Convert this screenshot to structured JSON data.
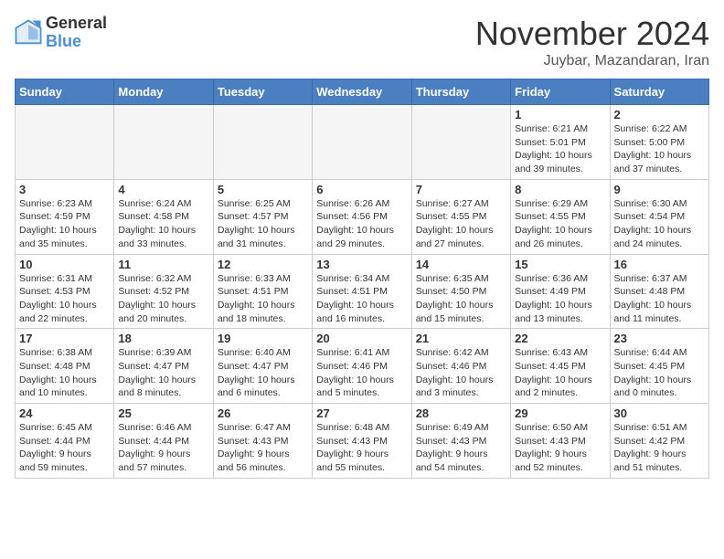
{
  "header": {
    "logo_general": "General",
    "logo_blue": "Blue",
    "month_title": "November 2024",
    "location": "Juybar, Mazandaran, Iran"
  },
  "weekdays": [
    "Sunday",
    "Monday",
    "Tuesday",
    "Wednesday",
    "Thursday",
    "Friday",
    "Saturday"
  ],
  "weeks": [
    [
      {
        "day": "",
        "info": ""
      },
      {
        "day": "",
        "info": ""
      },
      {
        "day": "",
        "info": ""
      },
      {
        "day": "",
        "info": ""
      },
      {
        "day": "",
        "info": ""
      },
      {
        "day": "1",
        "info": "Sunrise: 6:21 AM\nSunset: 5:01 PM\nDaylight: 10 hours\nand 39 minutes."
      },
      {
        "day": "2",
        "info": "Sunrise: 6:22 AM\nSunset: 5:00 PM\nDaylight: 10 hours\nand 37 minutes."
      }
    ],
    [
      {
        "day": "3",
        "info": "Sunrise: 6:23 AM\nSunset: 4:59 PM\nDaylight: 10 hours\nand 35 minutes."
      },
      {
        "day": "4",
        "info": "Sunrise: 6:24 AM\nSunset: 4:58 PM\nDaylight: 10 hours\nand 33 minutes."
      },
      {
        "day": "5",
        "info": "Sunrise: 6:25 AM\nSunset: 4:57 PM\nDaylight: 10 hours\nand 31 minutes."
      },
      {
        "day": "6",
        "info": "Sunrise: 6:26 AM\nSunset: 4:56 PM\nDaylight: 10 hours\nand 29 minutes."
      },
      {
        "day": "7",
        "info": "Sunrise: 6:27 AM\nSunset: 4:55 PM\nDaylight: 10 hours\nand 27 minutes."
      },
      {
        "day": "8",
        "info": "Sunrise: 6:29 AM\nSunset: 4:55 PM\nDaylight: 10 hours\nand 26 minutes."
      },
      {
        "day": "9",
        "info": "Sunrise: 6:30 AM\nSunset: 4:54 PM\nDaylight: 10 hours\nand 24 minutes."
      }
    ],
    [
      {
        "day": "10",
        "info": "Sunrise: 6:31 AM\nSunset: 4:53 PM\nDaylight: 10 hours\nand 22 minutes."
      },
      {
        "day": "11",
        "info": "Sunrise: 6:32 AM\nSunset: 4:52 PM\nDaylight: 10 hours\nand 20 minutes."
      },
      {
        "day": "12",
        "info": "Sunrise: 6:33 AM\nSunset: 4:51 PM\nDaylight: 10 hours\nand 18 minutes."
      },
      {
        "day": "13",
        "info": "Sunrise: 6:34 AM\nSunset: 4:51 PM\nDaylight: 10 hours\nand 16 minutes."
      },
      {
        "day": "14",
        "info": "Sunrise: 6:35 AM\nSunset: 4:50 PM\nDaylight: 10 hours\nand 15 minutes."
      },
      {
        "day": "15",
        "info": "Sunrise: 6:36 AM\nSunset: 4:49 PM\nDaylight: 10 hours\nand 13 minutes."
      },
      {
        "day": "16",
        "info": "Sunrise: 6:37 AM\nSunset: 4:48 PM\nDaylight: 10 hours\nand 11 minutes."
      }
    ],
    [
      {
        "day": "17",
        "info": "Sunrise: 6:38 AM\nSunset: 4:48 PM\nDaylight: 10 hours\nand 10 minutes."
      },
      {
        "day": "18",
        "info": "Sunrise: 6:39 AM\nSunset: 4:47 PM\nDaylight: 10 hours\nand 8 minutes."
      },
      {
        "day": "19",
        "info": "Sunrise: 6:40 AM\nSunset: 4:47 PM\nDaylight: 10 hours\nand 6 minutes."
      },
      {
        "day": "20",
        "info": "Sunrise: 6:41 AM\nSunset: 4:46 PM\nDaylight: 10 hours\nand 5 minutes."
      },
      {
        "day": "21",
        "info": "Sunrise: 6:42 AM\nSunset: 4:46 PM\nDaylight: 10 hours\nand 3 minutes."
      },
      {
        "day": "22",
        "info": "Sunrise: 6:43 AM\nSunset: 4:45 PM\nDaylight: 10 hours\nand 2 minutes."
      },
      {
        "day": "23",
        "info": "Sunrise: 6:44 AM\nSunset: 4:45 PM\nDaylight: 10 hours\nand 0 minutes."
      }
    ],
    [
      {
        "day": "24",
        "info": "Sunrise: 6:45 AM\nSunset: 4:44 PM\nDaylight: 9 hours\nand 59 minutes."
      },
      {
        "day": "25",
        "info": "Sunrise: 6:46 AM\nSunset: 4:44 PM\nDaylight: 9 hours\nand 57 minutes."
      },
      {
        "day": "26",
        "info": "Sunrise: 6:47 AM\nSunset: 4:43 PM\nDaylight: 9 hours\nand 56 minutes."
      },
      {
        "day": "27",
        "info": "Sunrise: 6:48 AM\nSunset: 4:43 PM\nDaylight: 9 hours\nand 55 minutes."
      },
      {
        "day": "28",
        "info": "Sunrise: 6:49 AM\nSunset: 4:43 PM\nDaylight: 9 hours\nand 54 minutes."
      },
      {
        "day": "29",
        "info": "Sunrise: 6:50 AM\nSunset: 4:43 PM\nDaylight: 9 hours\nand 52 minutes."
      },
      {
        "day": "30",
        "info": "Sunrise: 6:51 AM\nSunset: 4:42 PM\nDaylight: 9 hours\nand 51 minutes."
      }
    ]
  ]
}
